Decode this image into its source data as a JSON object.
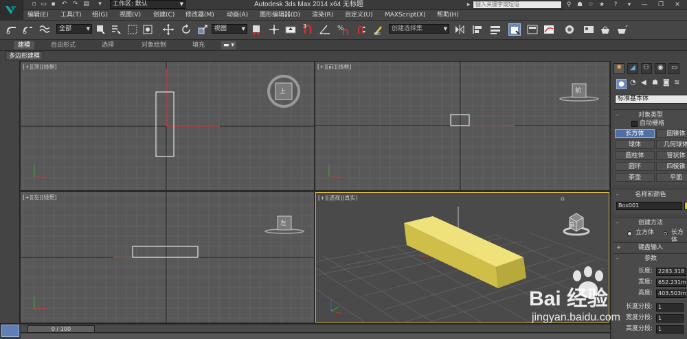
{
  "app": {
    "title": "Autodesk 3ds Max  2014 x64      无标题",
    "workspace_label": "工作区: 默认",
    "search_placeholder": "键入关键字或短语"
  },
  "menubar": [
    {
      "id": "edit",
      "label": "编辑(E)"
    },
    {
      "id": "tools",
      "label": "工具(T)"
    },
    {
      "id": "group",
      "label": "组(G)"
    },
    {
      "id": "views",
      "label": "视图(V)"
    },
    {
      "id": "create",
      "label": "创建(C)"
    },
    {
      "id": "modifiers",
      "label": "修改器(M)"
    },
    {
      "id": "animation",
      "label": "动画(A)"
    },
    {
      "id": "graph-editors",
      "label": "图形编辑器(D)"
    },
    {
      "id": "rendering",
      "label": "渲染(R)"
    },
    {
      "id": "customize",
      "label": "自定义(U)"
    },
    {
      "id": "maxscript",
      "label": "MAXScript(X)"
    },
    {
      "id": "help",
      "label": "帮助(H)"
    }
  ],
  "toolbar": {
    "selection_filter": "全部",
    "ref_coord": "视图",
    "named_selection": "创建选择集",
    "snap_number_2": "2",
    "snap_number_3": "3"
  },
  "ribbon": {
    "tabs": [
      "建模",
      "自由形式",
      "选择",
      "对象绘制",
      "填充"
    ],
    "active_tab": "建模",
    "subtab": "多边形建模"
  },
  "viewports": {
    "top": {
      "label_plus": "[+]",
      "label_view": "[顶]",
      "label_shade": "[线框]",
      "cube_label": "上"
    },
    "front": {
      "label_plus": "[+]",
      "label_view": "[前]",
      "label_shade": "[线框]",
      "cube_label": "前"
    },
    "left": {
      "label_plus": "[+]",
      "label_view": "[左]",
      "label_shade": "[线框]",
      "cube_label": "左"
    },
    "perspective": {
      "label_plus": "[+]",
      "label_view": "[透视]",
      "label_shade": "[真实]",
      "cube_label": "前"
    }
  },
  "command_panel": {
    "category": "标准基本体",
    "object_type": {
      "title": "对象类型",
      "autogrid": "自动栅格",
      "buttons": [
        "长方体",
        "圆锥体",
        "球体",
        "几何球体",
        "圆柱体",
        "管状体",
        "圆环",
        "四棱锥",
        "茶壶",
        "平面"
      ],
      "active": "长方体"
    },
    "name_color": {
      "title": "名称和颜色",
      "name": "Box001",
      "color": "#d4d400"
    },
    "creation_method": {
      "title": "创建方法",
      "options": [
        "立方体",
        "长方体"
      ],
      "selected": "长方体"
    },
    "keyboard_entry": {
      "title": "键盘输入"
    },
    "parameters": {
      "title": "参数",
      "length_label": "长度:",
      "length": "2283.318",
      "width_label": "宽度:",
      "width": "652.231m",
      "height_label": "高度:",
      "height": "403.503m",
      "length_segs_label": "长度分段:",
      "length_segs": "1",
      "width_segs_label": "宽度分段:",
      "width_segs": "1",
      "height_segs_label": "高度分段:",
      "height_segs": "1"
    }
  },
  "timeline": {
    "frame": "0 / 100"
  },
  "watermark": {
    "logo": "Bai 经验",
    "url": "jingyan.baidu.com"
  },
  "colors": {
    "accent": "#6c88b8",
    "box_yellow": "#e6d96a",
    "selection": "#ffffff",
    "x_axis": "#cc3333",
    "y_axis": "#33aa33"
  }
}
